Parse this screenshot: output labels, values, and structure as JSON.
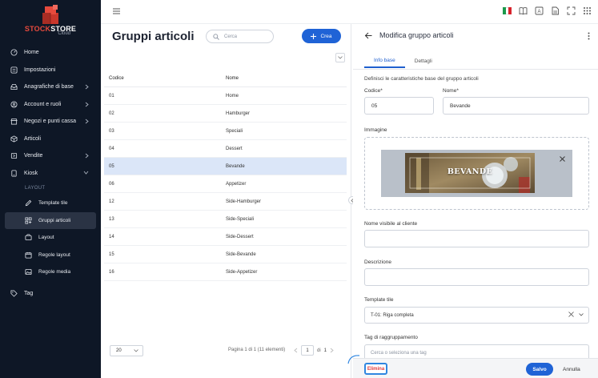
{
  "brand": {
    "name_part1": "STOCK",
    "name_part2": "STORE",
    "sub": "Cloud",
    "accent": "#e64a3d"
  },
  "sidebar": {
    "items": [
      {
        "label": "Home",
        "icon": "gauge-icon"
      },
      {
        "label": "Impostazioni",
        "icon": "sliders-icon"
      },
      {
        "label": "Anagrafiche di base",
        "icon": "inbox-icon",
        "chevron": "right"
      },
      {
        "label": "Account e ruoli",
        "icon": "user-circle-icon",
        "chevron": "right"
      },
      {
        "label": "Negozi e punti cassa",
        "icon": "store-icon",
        "chevron": "right"
      },
      {
        "label": "Articoli",
        "icon": "box-icon"
      },
      {
        "label": "Vendite",
        "icon": "cart-icon",
        "chevron": "right"
      },
      {
        "label": "Kiosk",
        "icon": "tablet-icon",
        "chevron": "down"
      }
    ],
    "section_label": "LAYOUT",
    "sub_items": [
      {
        "label": "Template tile",
        "icon": "pen-icon"
      },
      {
        "label": "Gruppi articoli",
        "icon": "grid-icon",
        "active": true
      },
      {
        "label": "Layout",
        "icon": "layout-icon"
      },
      {
        "label": "Regole layout",
        "icon": "calendar-icon"
      },
      {
        "label": "Regole media",
        "icon": "image-icon"
      }
    ],
    "tag_item": {
      "label": "Tag",
      "icon": "tag-icon"
    }
  },
  "topbar": {
    "icons": [
      "flag-italy-icon",
      "book-icon",
      "translate-icon",
      "document-icon",
      "fullscreen-icon",
      "grid-dots-icon"
    ]
  },
  "list": {
    "title": "Gruppi articoli",
    "search_placeholder": "Cerca",
    "create_label": "Crea",
    "columns": [
      "Codice",
      "Nome"
    ],
    "rows": [
      {
        "code": "01",
        "name": "Home"
      },
      {
        "code": "02",
        "name": "Hamburger"
      },
      {
        "code": "03",
        "name": "Speciali"
      },
      {
        "code": "04",
        "name": "Dessert"
      },
      {
        "code": "05",
        "name": "Bevande",
        "selected": true
      },
      {
        "code": "06",
        "name": "Appetizer"
      },
      {
        "code": "12",
        "name": "Side-Hamburger"
      },
      {
        "code": "13",
        "name": "Side-Speciali"
      },
      {
        "code": "14",
        "name": "Side-Dessert"
      },
      {
        "code": "15",
        "name": "Side-Bevande"
      },
      {
        "code": "16",
        "name": "Side-Appetizer"
      }
    ],
    "page_size": "20",
    "page_info": "Pagina 1 di 1 (11 elementi)",
    "page_current": "1",
    "page_of": "di",
    "page_total": "1"
  },
  "detail": {
    "title": "Modifica gruppo articoli",
    "tabs": [
      {
        "label": "Info base",
        "active": true
      },
      {
        "label": "Dettagli"
      }
    ],
    "intro": "Definisci le caratteristiche base del gruppo articoli",
    "code_label": "Codice*",
    "code_value": "05",
    "name_label": "Nome*",
    "name_value": "Bevande",
    "image_label": "Immagine",
    "image_banner_text": "BEVANDE",
    "display_name_label": "Nome visibile al cliente",
    "display_name_value": "",
    "description_label": "Descrizione",
    "description_value": "",
    "template_label": "Template tile",
    "template_value": "T-01: Riga completa",
    "tag_label": "Tag di raggruppamento",
    "tag_placeholder": "Cerca o seleziona una tag",
    "delete_label": "Elimina",
    "save_label": "Salvo",
    "cancel_label": "Annulla"
  },
  "colors": {
    "primary": "#1f63d6",
    "sidebar_bg": "#0e1726",
    "selected_row": "#dbe6f8",
    "danger": "#e03b3b"
  }
}
